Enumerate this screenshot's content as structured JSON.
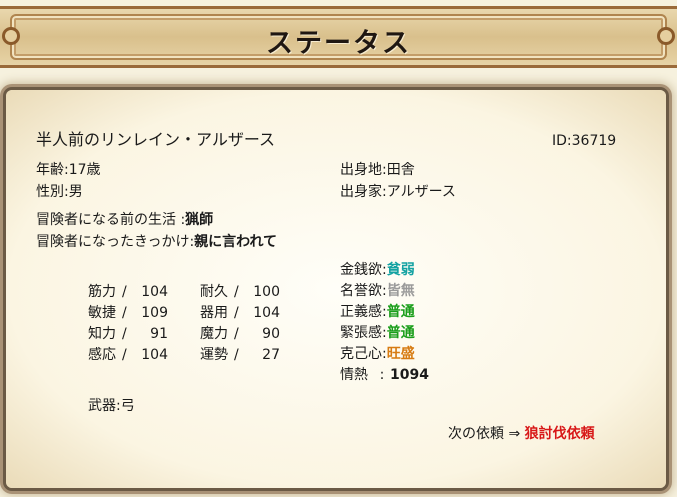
{
  "header": {
    "title": "ステータス"
  },
  "profile": {
    "name": "半人前のリンレイン・アルザース",
    "id_label": "ID:",
    "id_value": "36719",
    "age_label": "年齢:",
    "age_value": "17歳",
    "gender_label": "性別:",
    "gender_value": "男",
    "birthplace_label": "出身地:",
    "birthplace_value": "田舎",
    "family_label": "出身家:",
    "family_value": "アルザース",
    "prev_life_label": "冒険者になる前の生活 :",
    "prev_life_value": "猟師",
    "reason_label": "冒険者になったきっかけ:",
    "reason_value": "親に言われて"
  },
  "stats": [
    {
      "label": "筋力",
      "sep": "/",
      "value": "104"
    },
    {
      "label": "耐久",
      "sep": "/",
      "value": "100"
    },
    {
      "label": "敏捷",
      "sep": "/",
      "value": "109"
    },
    {
      "label": "器用",
      "sep": "/",
      "value": "104"
    },
    {
      "label": "知力",
      "sep": "/",
      "value": "91"
    },
    {
      "label": "魔力",
      "sep": "/",
      "value": "90"
    },
    {
      "label": "感応",
      "sep": "/",
      "value": "104"
    },
    {
      "label": "運勢",
      "sep": "/",
      "value": "27"
    }
  ],
  "traits": [
    {
      "label": "金銭欲:",
      "value": "貧弱",
      "color": "#14a2a2"
    },
    {
      "label": "名誉欲:",
      "value": "皆無",
      "color": "#9a9a9a"
    },
    {
      "label": "正義感:",
      "value": "普通",
      "color": "#1a9e1a"
    },
    {
      "label": "緊張感:",
      "value": "普通",
      "color": "#1a9e1a"
    },
    {
      "label": "克己心:",
      "value": "旺盛",
      "color": "#d77b12"
    },
    {
      "label": "情熱",
      "sep": ":",
      "value": "1094"
    }
  ],
  "weapon": {
    "label": "武器:",
    "value": "弓"
  },
  "next": {
    "label": "次の依頼",
    "arrow": "⇒",
    "value": "狼討伐依頼"
  }
}
